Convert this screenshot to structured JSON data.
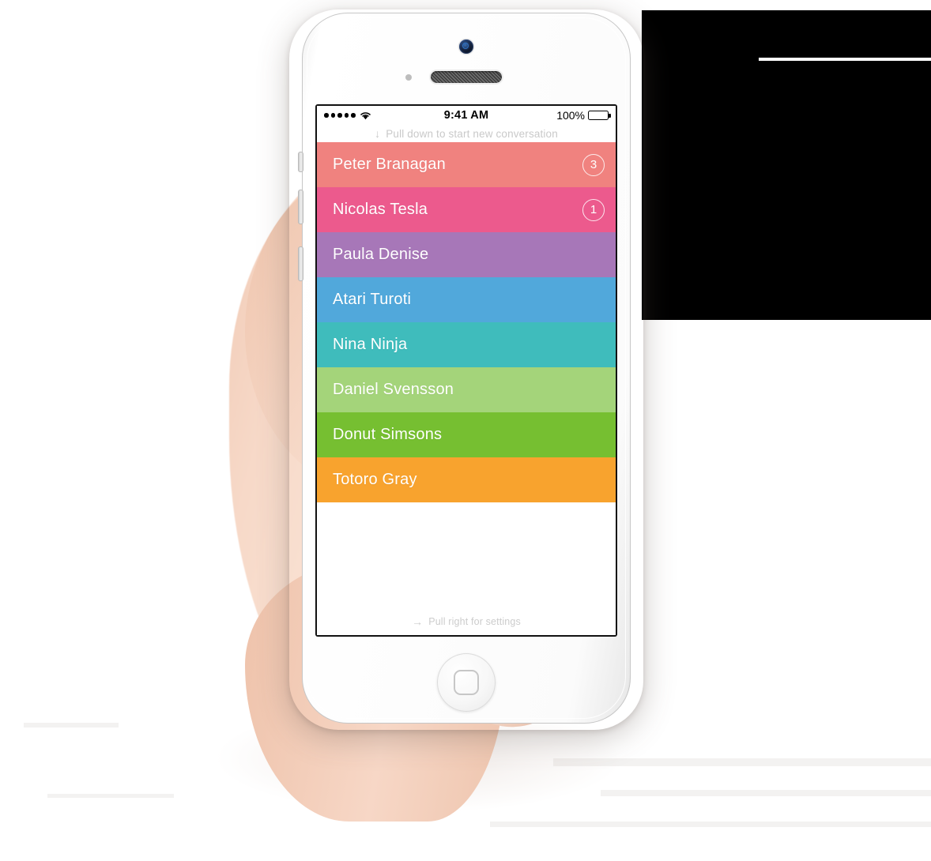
{
  "device": {
    "name": "iphone-5s-white",
    "home_button": "home-button",
    "front_camera": "camera-icon",
    "earpiece": "speaker-icon"
  },
  "statusbar": {
    "signal_dots": 5,
    "wifi": "wifi-icon",
    "time": "9:41 AM",
    "battery_percent": "100%",
    "battery_level": 100
  },
  "top_hint": {
    "arrow": "↓",
    "label": "Pull down to start new conversation"
  },
  "bottom_hint": {
    "arrow": "→",
    "label": "Pull right for settings"
  },
  "conversations": [
    {
      "name": "Peter Branagan",
      "badge": "3",
      "color": "#f0827f"
    },
    {
      "name": "Nicolas Tesla",
      "badge": "1",
      "color": "#ec5a8d"
    },
    {
      "name": "Paula Denise",
      "badge": "",
      "color": "#a777b8"
    },
    {
      "name": "Atari Turoti",
      "badge": "",
      "color": "#51a8db"
    },
    {
      "name": "Nina Ninja",
      "badge": "",
      "color": "#3fbcbc"
    },
    {
      "name": "Daniel Svensson",
      "badge": "",
      "color": "#a4d47a"
    },
    {
      "name": "Donut Simsons",
      "badge": "",
      "color": "#76bf31"
    },
    {
      "name": "Totoro Gray",
      "badge": "",
      "color": "#f8a32e"
    }
  ],
  "colors": {
    "screen_background": "#ffffff",
    "hint_text": "#c9c9c9",
    "row_text": "#ffffff",
    "bezel": "#111111"
  }
}
